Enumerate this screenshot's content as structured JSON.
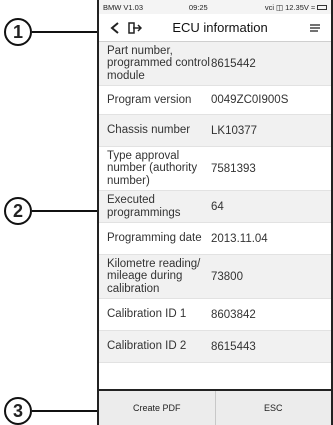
{
  "callouts": {
    "one": "1",
    "two": "2",
    "three": "3"
  },
  "status_bar": {
    "app_version": "BMW V1.03",
    "time": "09:25",
    "battery_voltage": "12.35V"
  },
  "header": {
    "title": "ECU information"
  },
  "rows": [
    {
      "label": "Part number, programmed control module",
      "value": "8615442"
    },
    {
      "label": "Program version",
      "value": "0049ZC0I900S"
    },
    {
      "label": "Chassis number",
      "value": "LK10377"
    },
    {
      "label": "Type approval number (authority number)",
      "value": "7581393"
    },
    {
      "label": "Executed programmings",
      "value": "64"
    },
    {
      "label": "Programming date",
      "value": "2013.11.04"
    },
    {
      "label": "Kilometre reading/ mileage during calibration",
      "value": "73800"
    },
    {
      "label": "Calibration ID 1",
      "value": "8603842"
    },
    {
      "label": "Calibration ID 2",
      "value": "8615443"
    }
  ],
  "footer": {
    "create_pdf_label": "Create PDF",
    "esc_label": "ESC"
  }
}
